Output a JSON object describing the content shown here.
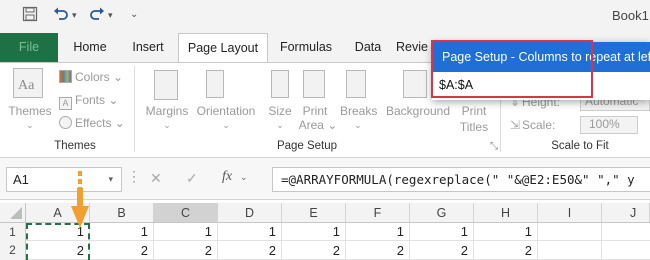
{
  "titlebar": {
    "book_title": "Book1",
    "icons": [
      "save-icon",
      "undo-icon",
      "redo-icon",
      "customize-dropdown-icon"
    ]
  },
  "tabs": [
    {
      "label": "File"
    },
    {
      "label": "Home"
    },
    {
      "label": "Insert"
    },
    {
      "label": "Page Layout",
      "active": true
    },
    {
      "label": "Formulas"
    },
    {
      "label": "Data"
    },
    {
      "label": "Revie"
    }
  ],
  "ribbon": {
    "themes_group": {
      "themes_label": "Themes",
      "colors_label": "Colors",
      "fonts_label": "Fonts",
      "effects_label": "Effects",
      "group_name": "Themes"
    },
    "page_setup_group": {
      "margins_label": "Margins",
      "orientation_label": "Orientation",
      "size_label": "Size",
      "print_area_label_1": "Print",
      "print_area_label_2": "Area",
      "breaks_label": "Breaks",
      "background_label": "Background",
      "print_titles_label_1": "Print",
      "print_titles_label_2": "Titles",
      "group_name": "Page Setup"
    },
    "scale_group": {
      "height_label": "Height:",
      "height_value": "Automatic",
      "scale_label": "Scale:",
      "scale_value": "100%",
      "group_name": "Scale to Fit"
    }
  },
  "formula_bar": {
    "name_box": "A1",
    "fx_label": "fx",
    "formula": "=@ARRAYFORMULA(regexreplace(\" \"&@E2:E50&\" \",\" y"
  },
  "grid": {
    "columns": [
      "A",
      "B",
      "C",
      "D",
      "E",
      "F",
      "G",
      "H",
      "I",
      "J"
    ],
    "rows": [
      {
        "num": "1",
        "cells": [
          "1",
          "1",
          "1",
          "1",
          "1",
          "1",
          "1",
          "1",
          "",
          ""
        ]
      },
      {
        "num": "2",
        "cells": [
          "2",
          "2",
          "2",
          "2",
          "2",
          "2",
          "2",
          "2",
          "",
          ""
        ]
      }
    ]
  },
  "dialog": {
    "title": "Page Setup - Columns to repeat at left:",
    "value": "$A:$A"
  },
  "colors": {
    "file_tab": "#1e7145",
    "dialog_header": "#1f6fd6",
    "highlight_border": "#d9354a",
    "arrow": "#f0a030"
  }
}
